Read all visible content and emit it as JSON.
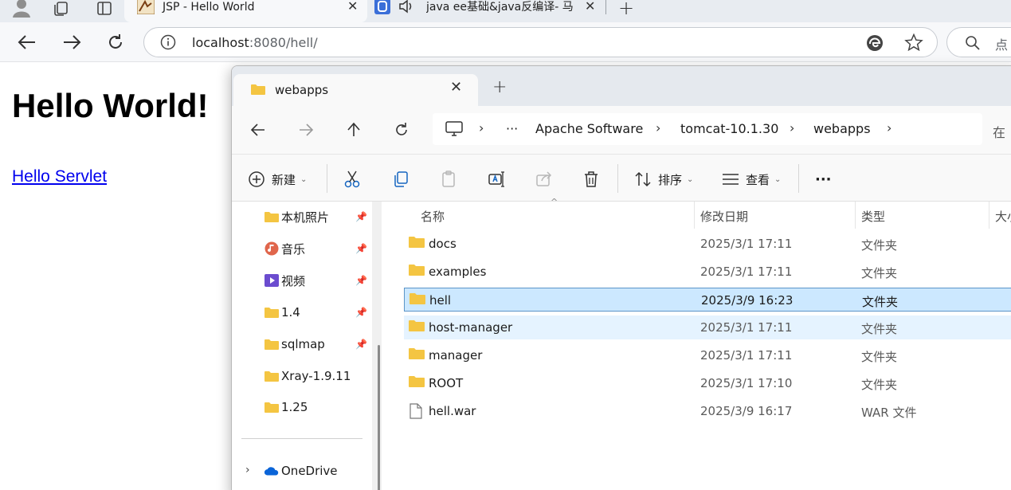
{
  "browser": {
    "tabs": [
      {
        "title": "JSP - Hello World",
        "active": true
      },
      {
        "title": "java ee基础&java反编译- 马"
      }
    ],
    "address": {
      "host": "localhost",
      "rest": ":8080/hell/"
    },
    "search_placeholder": "点"
  },
  "page": {
    "heading": "Hello World!",
    "link": "Hello Servlet"
  },
  "explorer": {
    "tab_title": "webapps",
    "breadcrumb": [
      "···",
      "Apache Software",
      "tomcat-10.1.30",
      "webapps"
    ],
    "search_hint": "在",
    "commands": {
      "new": "新建",
      "sort": "排序",
      "view": "查看",
      "more": "···"
    },
    "nav_items": [
      {
        "label": "本机照片",
        "icon": "folder-icon",
        "pinned": true
      },
      {
        "label": "音乐",
        "icon": "music-icon",
        "pinned": true
      },
      {
        "label": "视频",
        "icon": "video-icon",
        "pinned": true
      },
      {
        "label": "1.4",
        "icon": "folder-icon",
        "pinned": true
      },
      {
        "label": "sqlmap",
        "icon": "folder-icon",
        "pinned": true
      },
      {
        "label": "Xray-1.9.11",
        "icon": "folder-icon",
        "pinned": false
      },
      {
        "label": "1.25",
        "icon": "folder-icon",
        "pinned": false
      }
    ],
    "onedrive_label": "OneDrive",
    "columns": {
      "name": "名称",
      "modified": "修改日期",
      "type": "类型",
      "size": "大小"
    },
    "files": [
      {
        "name": "docs",
        "modified": "2025/3/1 17:11",
        "type": "文件夹",
        "kind": "folder"
      },
      {
        "name": "examples",
        "modified": "2025/3/1 17:11",
        "type": "文件夹",
        "kind": "folder"
      },
      {
        "name": "hell",
        "modified": "2025/3/9 16:23",
        "type": "文件夹",
        "kind": "folder",
        "state": "selected"
      },
      {
        "name": "host-manager",
        "modified": "2025/3/1 17:11",
        "type": "文件夹",
        "kind": "folder",
        "state": "hover"
      },
      {
        "name": "manager",
        "modified": "2025/3/1 17:11",
        "type": "文件夹",
        "kind": "folder"
      },
      {
        "name": "ROOT",
        "modified": "2025/3/1 17:10",
        "type": "文件夹",
        "kind": "folder"
      },
      {
        "name": "hell.war",
        "modified": "2025/3/9 16:17",
        "type": "WAR 文件",
        "kind": "file"
      }
    ],
    "colors": {
      "folder": "#f4c542",
      "selected_bg": "#cce8ff",
      "selected_border": "#5b94c7",
      "hover_bg": "#e5f3ff"
    }
  }
}
